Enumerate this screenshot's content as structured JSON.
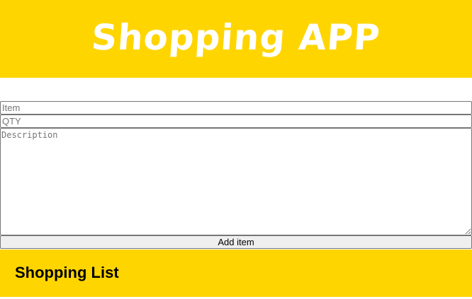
{
  "header": {
    "title": "Shopping APP"
  },
  "form": {
    "item_placeholder": "Item",
    "qty_placeholder": "QTY",
    "description_placeholder": "Description",
    "add_button_label": "Add item"
  },
  "list": {
    "title": "Shopping List"
  },
  "colors": {
    "accent": "#ffd500",
    "header_text": "#ffffff"
  }
}
